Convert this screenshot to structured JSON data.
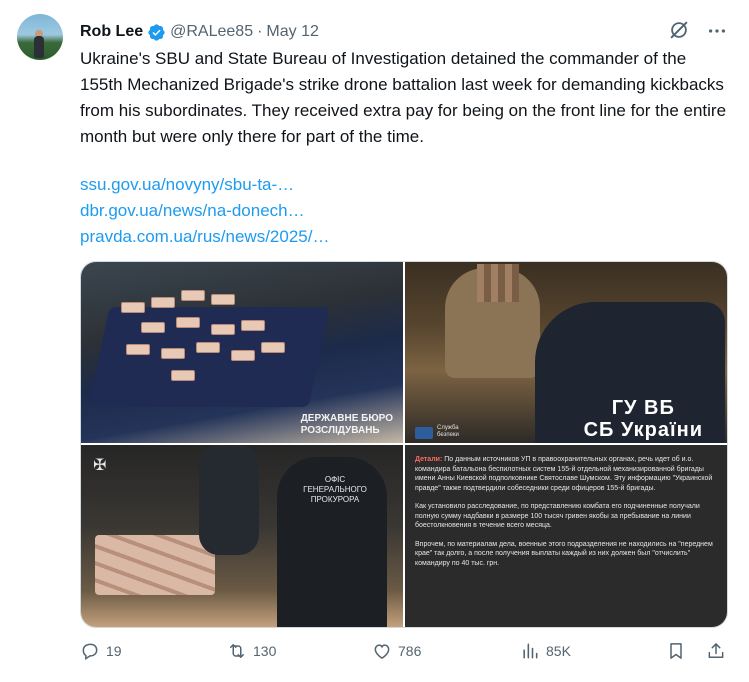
{
  "tweet": {
    "author_name": "Rob Lee",
    "handle": "@RALee85",
    "separator": "·",
    "date": "May 12",
    "text": "Ukraine's SBU and State Bureau of Investigation detained the commander of the 155th Mechanized Brigade's strike drone battalion last week for demanding kickbacks from his subordinates. They received extra pay for being on the front line for the entire month but were only there for part of the time.",
    "links": [
      "ssu.gov.ua/novyny/sbu-ta-…",
      "dbr.gov.ua/news/na-donech…",
      "pravda.com.ua/rus/news/2025/…"
    ]
  },
  "media": {
    "image1_watermark_line1": "ДЕРЖАВНЕ БЮРО",
    "image1_watermark_line2": "РОЗСЛІДУВАНЬ",
    "image2_watermark_line1": "ГУ ВБ",
    "image2_watermark_line2": "СБ України",
    "image2_seal_line1": "Служба",
    "image2_seal_line2": "безпеки",
    "image3_badge_line1": "ОФІС",
    "image3_badge_line2": "ГЕНЕРАЛЬНОГО",
    "image3_badge_line3": "ПРОКУРОРА",
    "image4_label": "Детали:",
    "image4_p1": "По данным источников УП в правоохранительных органах, речь идет об и.о. командира батальона беспилотных систем 155-й отдельной механизированной бригады имени Анны Киевской подполковнике Святославе Шумском. Эту информацию \"Украинской правде\" также подтвердили собеседники среди офицеров 155-й бригады.",
    "image4_p2": "Как установило расследование, по представлению комбата его подчиненные получали полную сумму надбавки в размере 100 тысяч гривен якобы за пребывание на линии боестолкновения в течение всего месяца.",
    "image4_p3": "Впрочем, по материалам дела, военные этого подразделения не находились на \"переднем крае\" так долго, а после получения выплаты каждый из них должен был \"отчислить\" командиру по 40 тыс. грн."
  },
  "actions": {
    "replies": "19",
    "retweets": "130",
    "likes": "786",
    "views": "85K"
  },
  "colors": {
    "accent": "#1d9bf0",
    "secondary_text": "#536471",
    "primary_text": "#0f1419"
  },
  "icons": [
    "verified-badge-icon",
    "grok-icon",
    "more-icon",
    "reply-icon",
    "retweet-icon",
    "like-icon",
    "views-icon",
    "bookmark-icon",
    "share-icon"
  ]
}
